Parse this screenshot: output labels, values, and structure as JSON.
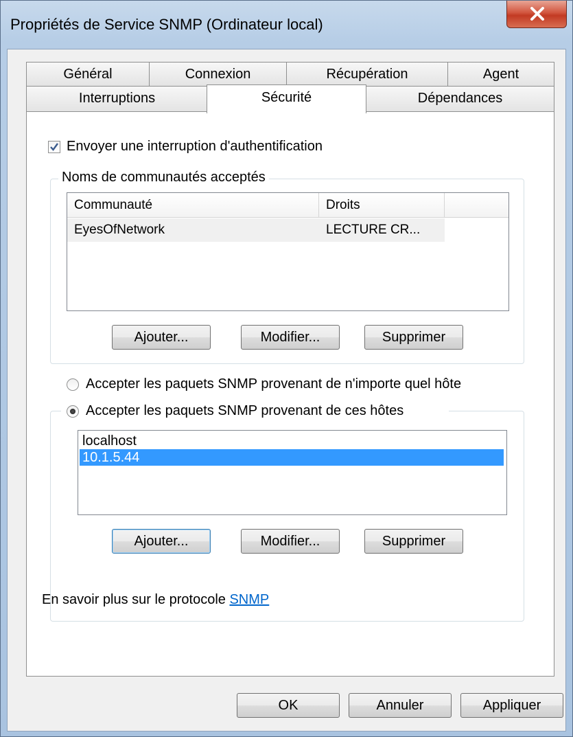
{
  "window": {
    "title": "Propriétés de Service SNMP (Ordinateur local)"
  },
  "tabs": {
    "row1": [
      {
        "label": "Général"
      },
      {
        "label": "Connexion"
      },
      {
        "label": "Récupération"
      },
      {
        "label": "Agent"
      }
    ],
    "row2": [
      {
        "label": "Interruptions"
      },
      {
        "label": "Sécurité",
        "active": true
      },
      {
        "label": "Dépendances"
      }
    ]
  },
  "security": {
    "send_auth_trap": {
      "label": "Envoyer une interruption d'authentification",
      "checked": true
    },
    "communities": {
      "legend": "Noms de communautés acceptés",
      "columns": [
        "Communauté",
        "Droits"
      ],
      "rows": [
        {
          "community": "EyesOfNetwork",
          "rights": "LECTURE CR..."
        }
      ],
      "buttons": {
        "add": "Ajouter...",
        "edit": "Modifier...",
        "remove": "Supprimer"
      }
    },
    "accept_any": {
      "label": "Accepter les paquets SNMP provenant de n'importe quel hôte",
      "selected": false
    },
    "accept_these": {
      "label": "Accepter les paquets SNMP provenant de ces hôtes",
      "selected": true
    },
    "hosts": {
      "items": [
        "localhost",
        "10.1.5.44"
      ],
      "selected_index": 1,
      "buttons": {
        "add": "Ajouter...",
        "edit": "Modifier...",
        "remove": "Supprimer"
      }
    },
    "learn_more": {
      "prefix": "En savoir plus sur le protocole ",
      "link": "SNMP"
    }
  },
  "footer": {
    "ok": "OK",
    "cancel": "Annuler",
    "apply": "Appliquer"
  },
  "colors": {
    "selection": "#3399ff",
    "link": "#0066cc",
    "close_button": "#c23a23"
  }
}
